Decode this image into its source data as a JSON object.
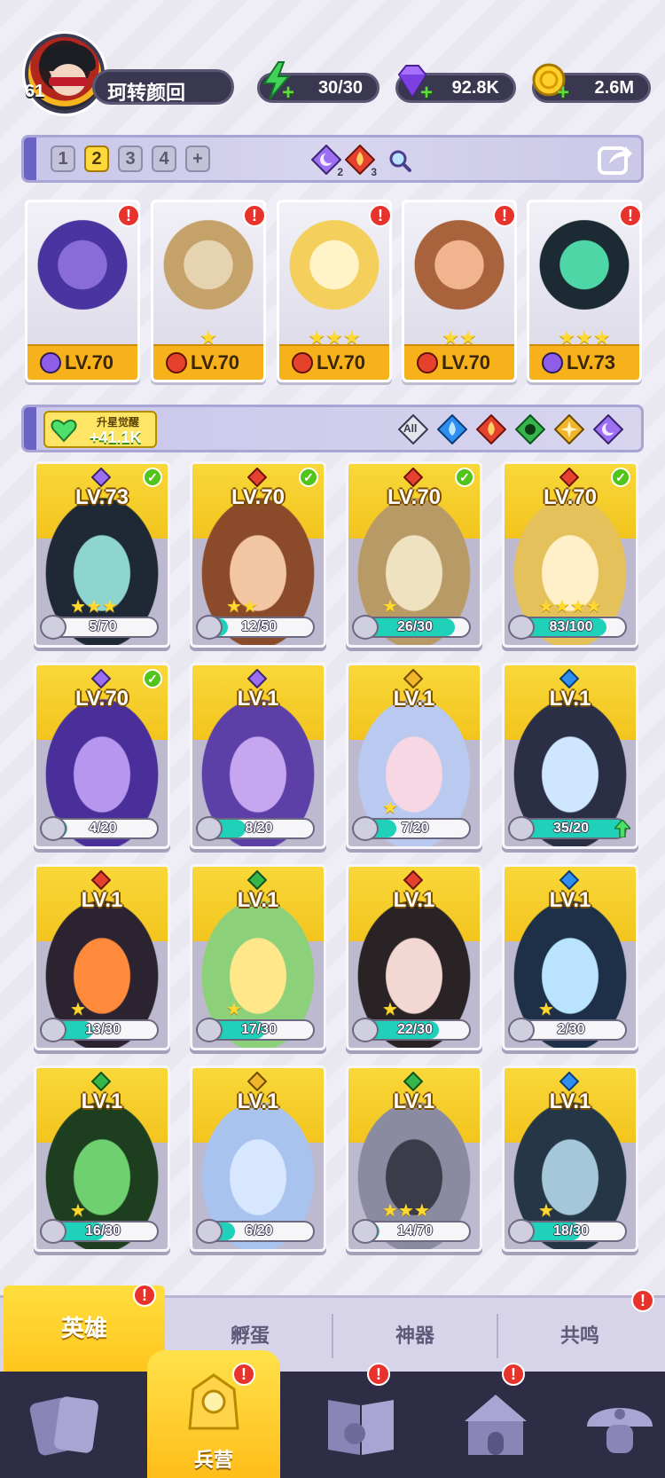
{
  "player": {
    "level": "61",
    "name": "珂转颜回"
  },
  "resources": {
    "energy": "30/30",
    "gems": "92.8K",
    "gold": "2.6M"
  },
  "team": {
    "tabs": [
      "1",
      "2",
      "3",
      "4"
    ],
    "active_tab": "2",
    "add_tab_label": "+",
    "stats": [
      {
        "icon": "moon-element-icon",
        "count": "2"
      },
      {
        "icon": "fire-element-icon",
        "count": "3"
      }
    ]
  },
  "lineup": [
    {
      "level": "LV.70",
      "element": "moon",
      "stars": "",
      "alert": "!"
    },
    {
      "level": "LV.70",
      "element": "fire",
      "stars": "★",
      "alert": "!"
    },
    {
      "level": "LV.70",
      "element": "fire",
      "stars": "★★★",
      "alert": "!"
    },
    {
      "level": "LV.70",
      "element": "fire",
      "stars": "★★",
      "alert": "!"
    },
    {
      "level": "LV.73",
      "element": "moon",
      "stars": "★★★",
      "alert": "!"
    }
  ],
  "filter": {
    "awaken_label": "升星觉醒",
    "awaken_value": "+41.1K",
    "all_label": "All",
    "elements": [
      "water",
      "fire",
      "nature",
      "light",
      "moon"
    ]
  },
  "heroes": [
    {
      "level": "LV.73",
      "element": "moon",
      "progress": "5/70",
      "fill": 0.07,
      "stars": "★★★",
      "check": true
    },
    {
      "level": "LV.70",
      "element": "fire",
      "progress": "12/50",
      "fill": 0.24,
      "stars": "★★",
      "check": true
    },
    {
      "level": "LV.70",
      "element": "fire",
      "progress": "26/30",
      "fill": 0.87,
      "stars": "★",
      "check": true
    },
    {
      "level": "LV.70",
      "element": "fire",
      "progress": "83/100",
      "fill": 0.83,
      "stars": "★★★★",
      "check": true
    },
    {
      "level": "LV.70",
      "element": "moon",
      "progress": "4/20",
      "fill": 0.2,
      "stars": "",
      "check": true
    },
    {
      "level": "LV.1",
      "element": "moon",
      "progress": "8/20",
      "fill": 0.4,
      "stars": "",
      "check": false
    },
    {
      "level": "LV.1",
      "element": "light",
      "progress": "7/20",
      "fill": 0.35,
      "stars": "★",
      "check": false
    },
    {
      "level": "LV.1",
      "element": "water",
      "progress": "35/20",
      "fill": 1.0,
      "stars": "",
      "check": false,
      "upgrade": true
    },
    {
      "level": "LV.1",
      "element": "fire",
      "progress": "13/30",
      "fill": 0.43,
      "stars": "★",
      "check": false
    },
    {
      "level": "LV.1",
      "element": "nature",
      "progress": "17/30",
      "fill": 0.57,
      "stars": "★",
      "check": false
    },
    {
      "level": "LV.1",
      "element": "fire",
      "progress": "22/30",
      "fill": 0.73,
      "stars": "★",
      "check": false
    },
    {
      "level": "LV.1",
      "element": "water",
      "progress": "2/30",
      "fill": 0.07,
      "stars": "★",
      "check": false
    },
    {
      "level": "LV.1",
      "element": "nature",
      "progress": "16/30",
      "fill": 0.53,
      "stars": "★",
      "check": false
    },
    {
      "level": "LV.1",
      "element": "light",
      "progress": "6/20",
      "fill": 0.3,
      "stars": "",
      "check": false
    },
    {
      "level": "LV.1",
      "element": "nature",
      "progress": "14/70",
      "fill": 0.2,
      "stars": "★★★",
      "check": false
    },
    {
      "level": "LV.1",
      "element": "water",
      "progress": "18/30",
      "fill": 0.6,
      "stars": "★",
      "check": false
    }
  ],
  "subtabs": {
    "heroes": "英雄",
    "hatch": "孵蛋",
    "artifact": "神器",
    "resonance": "共鸣"
  },
  "nav": {
    "barracks": "兵营"
  },
  "alert_mark": "!",
  "colors": {
    "accent_yellow": "#ffd93b",
    "nav_dark": "#2f2c45",
    "progress_teal": "#1fd1b8",
    "alert_red": "#e7332c"
  }
}
